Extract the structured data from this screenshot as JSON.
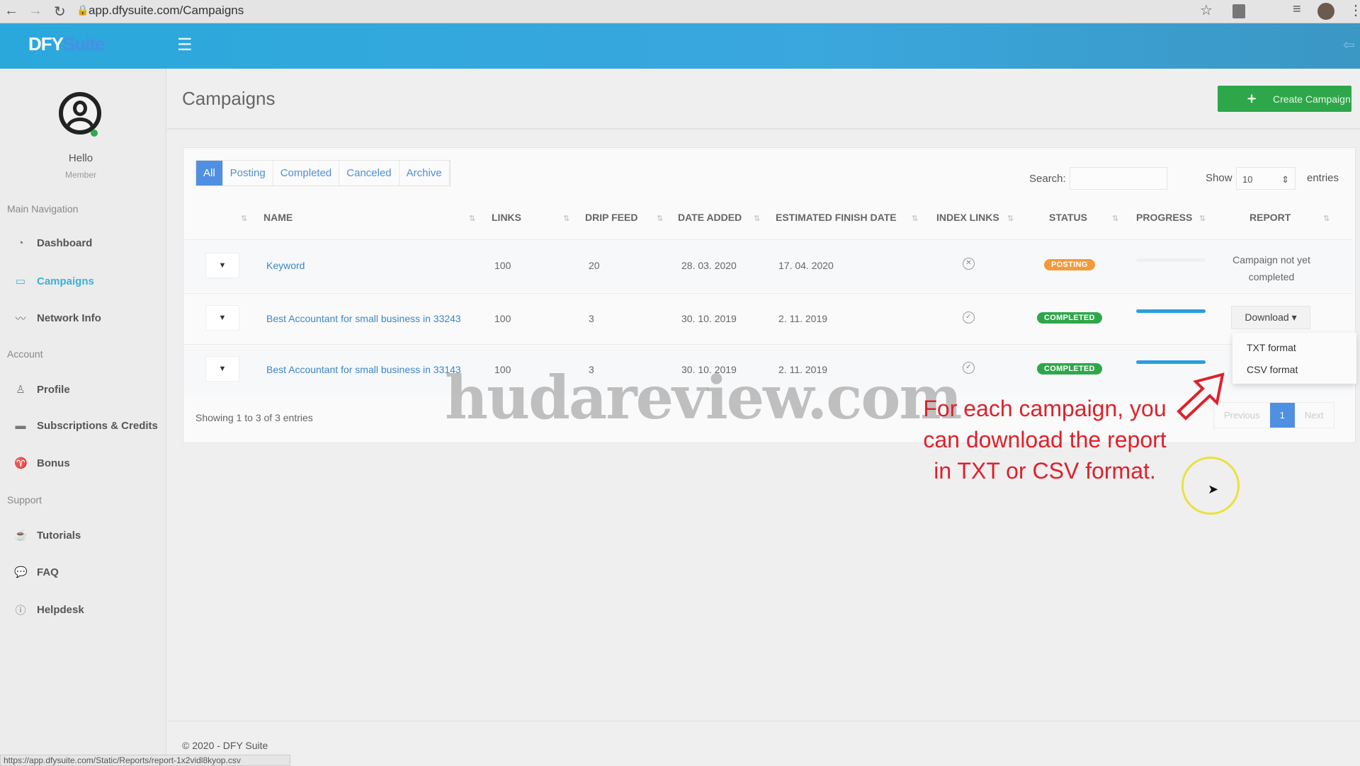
{
  "browser": {
    "url": "app.dfysuite.com/Campaigns",
    "status_url": "https://app.dfysuite.com/Static/Reports/report-1x2vidl8kyop.csv"
  },
  "header": {
    "logo_a": "DFY",
    "logo_b": "Suite",
    "menu_icon": "hamburger-icon",
    "logout_icon": "logout-icon"
  },
  "user": {
    "greeting": "Hello",
    "role": "Member"
  },
  "sidebar": {
    "sections": [
      {
        "title": "Main Navigation",
        "items": [
          {
            "label": "Dashboard",
            "icon": "gauge-icon"
          },
          {
            "label": "Campaigns",
            "icon": "folder-icon",
            "active": true
          },
          {
            "label": "Network Info",
            "icon": "chart-line-icon"
          }
        ]
      },
      {
        "title": "Account",
        "items": [
          {
            "label": "Profile",
            "icon": "user-icon"
          },
          {
            "label": "Subscriptions & Credits",
            "icon": "credit-card-icon"
          },
          {
            "label": "Bonus",
            "icon": "trophy-icon"
          }
        ]
      },
      {
        "title": "Support",
        "items": [
          {
            "label": "Tutorials",
            "icon": "coffee-icon"
          },
          {
            "label": "FAQ",
            "icon": "chat-icon"
          },
          {
            "label": "Helpdesk",
            "icon": "question-icon"
          }
        ]
      }
    ]
  },
  "page": {
    "title": "Campaigns",
    "create_label": "Create Campaign"
  },
  "filters": {
    "tabs": [
      "All",
      "Posting",
      "Completed",
      "Canceled",
      "Archive"
    ],
    "active": "All"
  },
  "search": {
    "label": "Search:",
    "value": ""
  },
  "length": {
    "show": "Show",
    "value": "10",
    "entries": "entries"
  },
  "table": {
    "columns": [
      "NAME",
      "LINKS",
      "DRIP FEED",
      "DATE ADDED",
      "ESTIMATED FINISH DATE",
      "INDEX LINKS",
      "STATUS",
      "PROGRESS",
      "REPORT"
    ],
    "rows": [
      {
        "name": "Keyword",
        "links": "100",
        "drip": "20",
        "added": "28. 03. 2020",
        "finish": "17. 04. 2020",
        "index": "x",
        "status": "POSTING",
        "status_color": "#f39a3a",
        "progress": 0,
        "report": "Campaign not yet completed"
      },
      {
        "name": "Best Accountant for small business in 33243",
        "links": "100",
        "drip": "3",
        "added": "30. 10. 2019",
        "finish": "2. 11. 2019",
        "index": "check",
        "status": "COMPLETED",
        "status_color": "#2ea74a",
        "progress": 100,
        "report": "Download"
      },
      {
        "name": "Best Accountant for small business in 33143",
        "links": "100",
        "drip": "3",
        "added": "30. 10. 2019",
        "finish": "2. 11. 2019",
        "index": "check",
        "status": "COMPLETED",
        "status_color": "#2ea74a",
        "progress": 100,
        "report": ""
      }
    ]
  },
  "download_menu": [
    "TXT format",
    "CSV format"
  ],
  "info": "Showing 1 to 3 of 3 entries",
  "pagination": {
    "prev": "Previous",
    "current": "1",
    "next": "Next"
  },
  "overlay": {
    "watermark": "hudareview.com",
    "note": [
      "For each campaign, you",
      "can download the report",
      "in TXT or CSV format."
    ]
  },
  "footer": "© 2020 - DFY Suite"
}
